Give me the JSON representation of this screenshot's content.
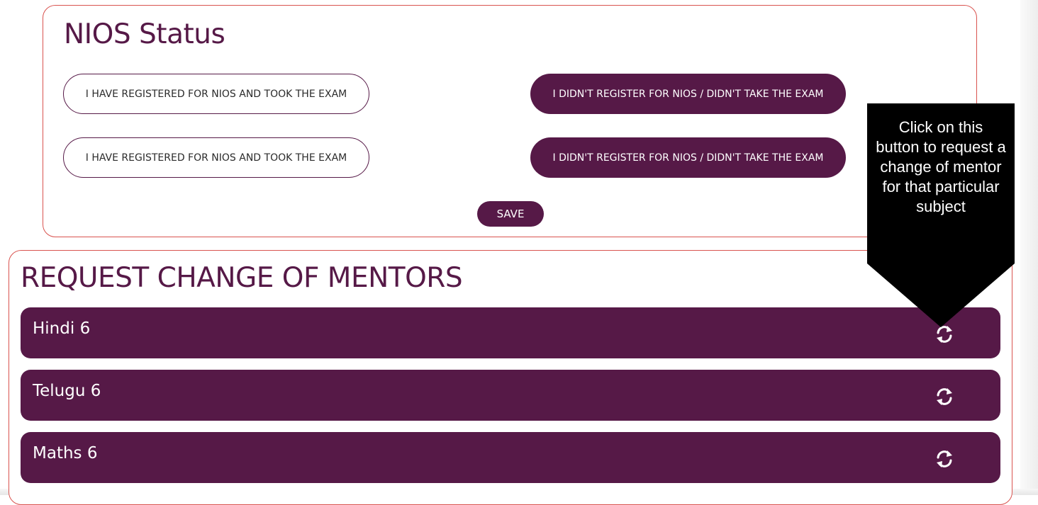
{
  "nios_status": {
    "title": "NIOS Status",
    "rows": [
      {
        "registered_label": "I HAVE REGISTERED FOR NIOS AND TOOK THE EXAM",
        "not_registered_label": "I DIDN'T REGISTER FOR NIOS / DIDN'T TAKE THE EXAM"
      },
      {
        "registered_label": "I HAVE REGISTERED FOR NIOS AND TOOK THE EXAM",
        "not_registered_label": "I DIDN'T REGISTER FOR NIOS / DIDN'T TAKE THE EXAM"
      }
    ],
    "save_label": "SAVE"
  },
  "mentors": {
    "title": "REQUEST CHANGE OF MENTORS",
    "subjects": [
      {
        "name": "Hindi 6",
        "action_icon": "refresh-icon"
      },
      {
        "name": "Telugu 6",
        "action_icon": "refresh-icon"
      },
      {
        "name": "Maths 6",
        "action_icon": "refresh-icon"
      }
    ]
  },
  "tooltip": {
    "text": "Click on this button to request a change of mentor for that particular subject"
  },
  "colors": {
    "brand": "#561947",
    "border": "#d9534f",
    "tooltip_bg": "#000000"
  }
}
